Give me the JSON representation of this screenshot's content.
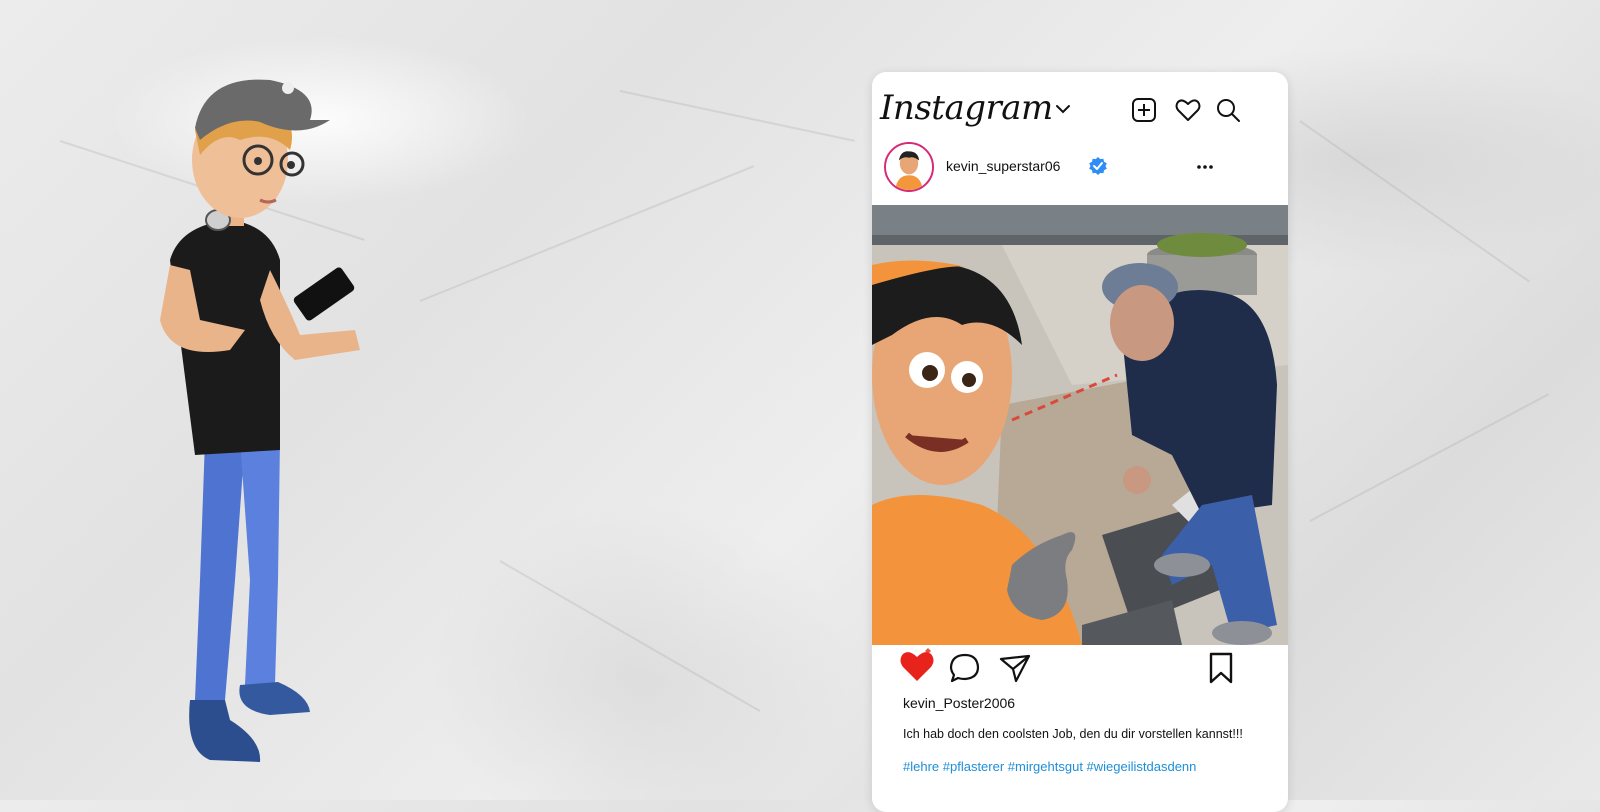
{
  "app": {
    "logo": "Instagram"
  },
  "post": {
    "account": "kevin_superstar06",
    "verified": true,
    "poster": "kevin_Poster2006",
    "caption": "Ich hab doch den coolsten Job, den du dir vorstellen kannst!!!",
    "hashtags": "#lehre #pflasterer #mirgehtsgut #wiegeilistdasdenn"
  },
  "icons": {
    "dropdown": "chevron-down-icon",
    "new_post": "plus-square-icon",
    "activity": "heart-icon",
    "search": "search-icon",
    "verified": "verified-badge-icon",
    "options": "more-dots-icon",
    "like": "heart-filled-icon",
    "comment": "comment-icon",
    "share": "send-icon",
    "save": "bookmark-icon"
  },
  "colors": {
    "like": "#e8231c",
    "hashtag": "#1e8fd6",
    "verified": "#2f8ef5",
    "avatar_ring": "#d62976"
  }
}
